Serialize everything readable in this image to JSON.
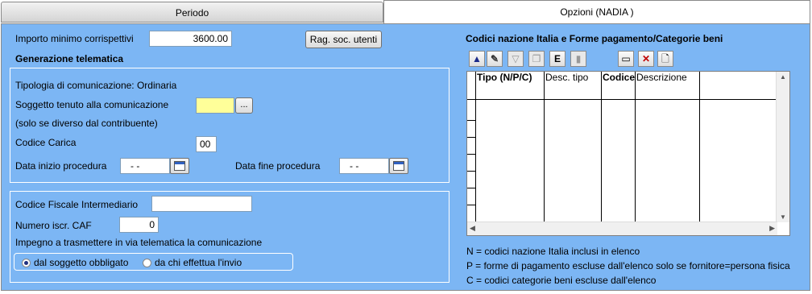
{
  "tabs": [
    {
      "label": "Periodo"
    },
    {
      "label": "Opzioni (NADIA    )"
    }
  ],
  "left": {
    "importo_label": "Importo minimo corrispettivi",
    "importo_value": "3600.00",
    "rag_soc_button": "Rag. soc. utenti",
    "generazione_label": "Generazione telematica",
    "tipologia": "Tipologia di comunicazione: Ordinaria",
    "soggetto_label": "Soggetto tenuto alla comunicazione",
    "soggetto_value": "",
    "browse_button": "...",
    "soggetto_note": "(solo se diverso dal contribuente)",
    "codice_carica_label": "Codice Carica",
    "codice_carica_value": "00",
    "data_inizio_label": "Data inizio procedura",
    "data_inizio_value": "- -",
    "data_fine_label": "Data fine procedura",
    "data_fine_value": "- -",
    "cf_intermediario_label": "Codice Fiscale Intermediario",
    "cf_intermediario_value": "",
    "numero_caf_label": "Numero iscr. CAF",
    "numero_caf_value": "0",
    "impegno_label": "Impegno a trasmettere in via telematica la comunicazione",
    "radio_options": [
      {
        "label": "dal soggetto obbligato",
        "selected": true
      },
      {
        "label": "da chi effettua l'invio",
        "selected": false
      }
    ]
  },
  "right": {
    "title": "Codici nazione Italia e Forme pagamento/Categorie beni",
    "toolbar": [
      {
        "icon": "up-arrow-icon"
      },
      {
        "icon": "edit-check-icon"
      },
      {
        "icon": "filter-icon"
      },
      {
        "icon": "copy-icon"
      },
      {
        "icon": "export-icon"
      },
      {
        "icon": "lock-icon"
      },
      {
        "icon": "window-icon"
      },
      {
        "icon": "delete-icon"
      },
      {
        "icon": "new-document-icon"
      }
    ],
    "columns": [
      "Tipo (N/P/C)",
      "Desc. tipo",
      "Codice",
      "Descrizione"
    ],
    "rows": [],
    "legend": [
      "N = codici nazione Italia inclusi in elenco",
      "P = forme di pagamento escluse dall'elenco solo se fornitore=persona fisica",
      "C = codici categorie beni escluse dall'elenco"
    ]
  },
  "colors": {
    "panel": "#7cb6f4",
    "field_highlight": "#ffff99"
  }
}
